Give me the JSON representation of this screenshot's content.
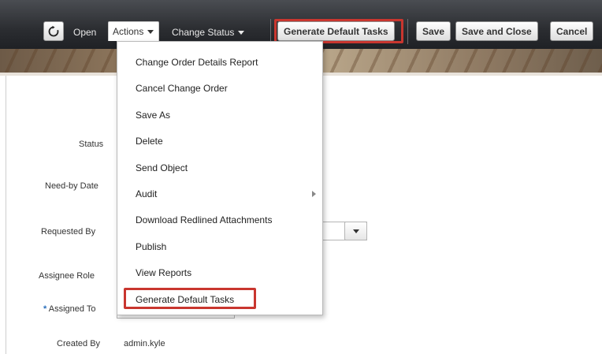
{
  "toolbar": {
    "open_label": "Open",
    "actions_label": "Actions",
    "change_status_label": "Change Status",
    "generate_default_tasks_label": "Generate Default Tasks",
    "save_label": "Save",
    "save_and_close_label": "Save and Close",
    "cancel_label": "Cancel"
  },
  "actions_menu": {
    "items": [
      {
        "label": "Change Order Details Report"
      },
      {
        "label": "Cancel Change Order"
      },
      {
        "label": "Save As"
      },
      {
        "label": "Delete"
      },
      {
        "label": "Send Object"
      },
      {
        "label": "Audit"
      },
      {
        "label": "Download Redlined Attachments"
      },
      {
        "label": "Publish"
      },
      {
        "label": "View Reports"
      },
      {
        "label": "Generate Default Tasks"
      }
    ]
  },
  "form": {
    "status_label": "Status",
    "need_by_date_label": "Need-by Date",
    "requested_by_label": "Requested By",
    "assignee_role_label": "Assignee Role",
    "assigned_to_required_marker": "*",
    "assigned_to_label": "Assigned To",
    "created_by_label": "Created By",
    "created_by_value": "admin.kyle"
  },
  "colors": {
    "highlight": "#c9362f",
    "toolbar_bg": "#2b2d31"
  }
}
